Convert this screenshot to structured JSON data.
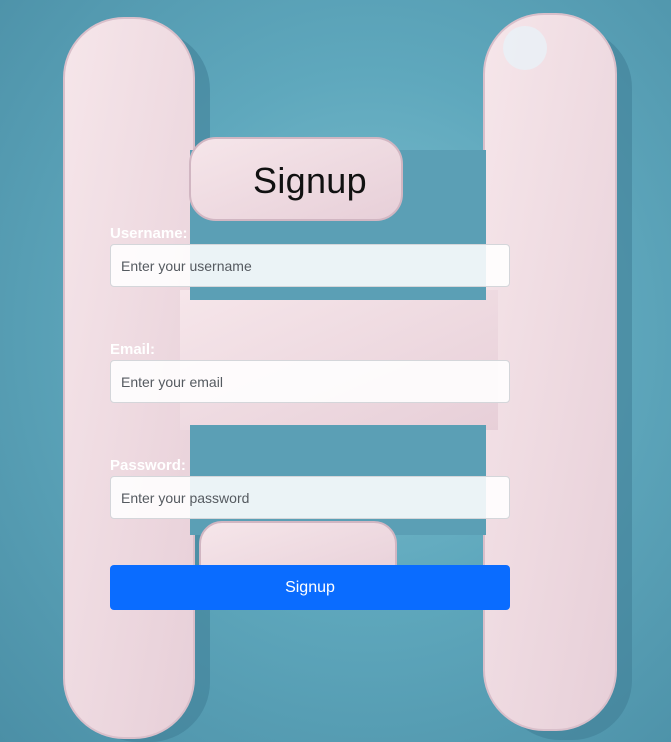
{
  "form": {
    "title": "Signup",
    "username": {
      "label": "Username:",
      "placeholder": "Enter your username"
    },
    "email": {
      "label": "Email:",
      "placeholder": "Enter your email"
    },
    "password": {
      "label": "Password:",
      "placeholder": "Enter your password"
    },
    "submit_label": "Signup"
  },
  "colors": {
    "background": "#5fa8bd",
    "logo": "#f1dde3",
    "button": "#0a6cff"
  },
  "background_logo": "H-logo"
}
